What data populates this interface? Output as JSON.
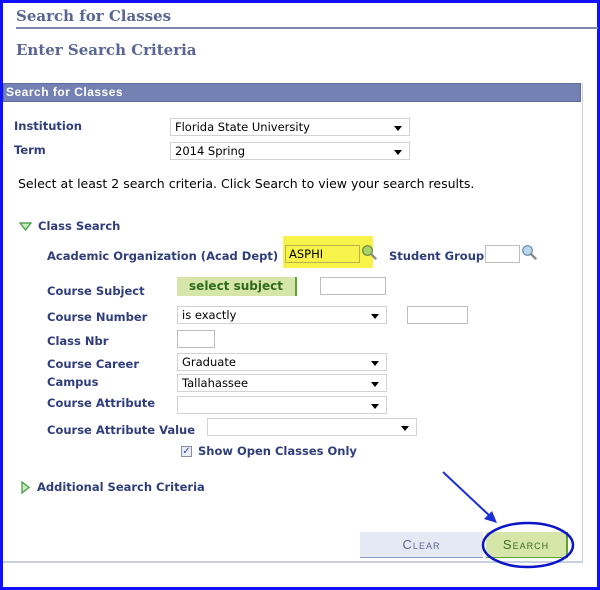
{
  "page": {
    "title": "Search for Classes",
    "subtitle": "Enter Search Criteria"
  },
  "panel": {
    "header": "Search for Classes",
    "institution": {
      "label": "Institution",
      "value": "Florida State University"
    },
    "term": {
      "label": "Term",
      "value": "2014 Spring"
    },
    "instructions": "Select at least 2 search criteria. Click Search to view your search results."
  },
  "class_search": {
    "toggle_label": "Class Search",
    "acad_org": {
      "label": "Academic Organization (Acad Dept)",
      "value": "ASPHI"
    },
    "student_group": {
      "label": "Student Group",
      "value": ""
    },
    "course_subject": {
      "label": "Course Subject",
      "button": "select subject",
      "value": ""
    },
    "course_number": {
      "label": "Course Number",
      "operator": "is exactly",
      "value": ""
    },
    "class_nbr": {
      "label": "Class Nbr",
      "value": ""
    },
    "course_career": {
      "label": "Course Career",
      "value": "Graduate"
    },
    "campus": {
      "label": "Campus",
      "value": "Tallahassee"
    },
    "course_attribute": {
      "label": "Course Attribute",
      "value": ""
    },
    "course_attribute_value": {
      "label": "Course Attribute Value",
      "value": ""
    },
    "show_open": {
      "label": "Show Open Classes Only",
      "checked": true
    }
  },
  "additional": {
    "toggle_label": "Additional Search Criteria"
  },
  "buttons": {
    "clear": "Clear",
    "search": "Search"
  },
  "colors": {
    "annotation_blue": "#1010ff",
    "header_bg": "#7381b3",
    "label": "#2f3d7a",
    "search_button_bg": "#d6e6aa",
    "highlight": "#f7f34a"
  }
}
